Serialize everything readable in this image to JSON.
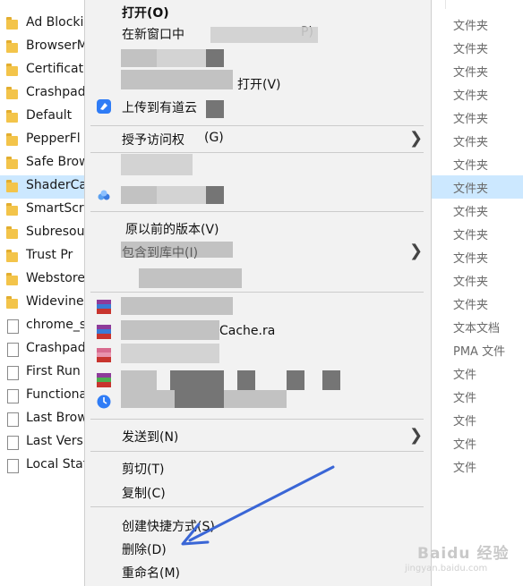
{
  "file_list": [
    {
      "name": "Ad Blocki",
      "type": "文件夹",
      "kind": "folder"
    },
    {
      "name": "BrowserM",
      "type": "文件夹",
      "kind": "folder"
    },
    {
      "name": "Certificate",
      "type": "文件夹",
      "kind": "folder"
    },
    {
      "name": "Crashpad",
      "type": "文件夹",
      "kind": "folder"
    },
    {
      "name": "Default",
      "type": "文件夹",
      "kind": "folder"
    },
    {
      "name": "PepperFl",
      "type": "文件夹",
      "kind": "folder"
    },
    {
      "name": "Safe Brow",
      "type": "文件夹",
      "kind": "folder"
    },
    {
      "name": "ShaderCa",
      "type": "文件夹",
      "kind": "folder",
      "selected": true
    },
    {
      "name": "SmartScre",
      "type": "文件夹",
      "kind": "folder"
    },
    {
      "name": "Subresou",
      "type": "文件夹",
      "kind": "folder"
    },
    {
      "name": "Trust Pr",
      "type": "文件夹",
      "kind": "folder"
    },
    {
      "name": "Webstore",
      "type": "文件夹",
      "kind": "folder"
    },
    {
      "name": "Widevine",
      "type": "文件夹",
      "kind": "folder"
    },
    {
      "name": "chrome_s",
      "type": "文本文档",
      "kind": "file"
    },
    {
      "name": "Crashpad",
      "type": "PMA 文件",
      "kind": "file"
    },
    {
      "name": "First Run",
      "type": "文件",
      "kind": "file"
    },
    {
      "name": "Functiona",
      "type": "文件",
      "kind": "file"
    },
    {
      "name": "Last Brow",
      "type": "文件",
      "kind": "file"
    },
    {
      "name": "Last Versi",
      "type": "文件",
      "kind": "file"
    },
    {
      "name": "Local Stat",
      "type": "文件",
      "kind": "file"
    }
  ],
  "context_menu": {
    "open": "打开(O)",
    "open_new_window": "在新窗口中",
    "open_new_window_tail": "P)",
    "open_with_tail": "打开(V)",
    "upload_youdao": "上传到有道云",
    "grant_access": "授予访问权",
    "grant_access_tail": "(G)",
    "restore_versions": "原以前的版本(V)",
    "include_library": "包含到库中(I)",
    "cache_text": "Cache.ra",
    "send_to": "发送到(N)",
    "cut": "剪切(T)",
    "copy": "复制(C)",
    "create_shortcut": "创建快捷方式(S)",
    "delete": "删除(D)",
    "rename": "重命名(M)"
  },
  "watermark": {
    "text": "Baidu 经验",
    "sub": "jingyan.baidu.com"
  },
  "colors": {
    "selected_row": "#cce8ff",
    "arrow": "#3a66d6",
    "menu_bg": "#f2f2f2"
  }
}
